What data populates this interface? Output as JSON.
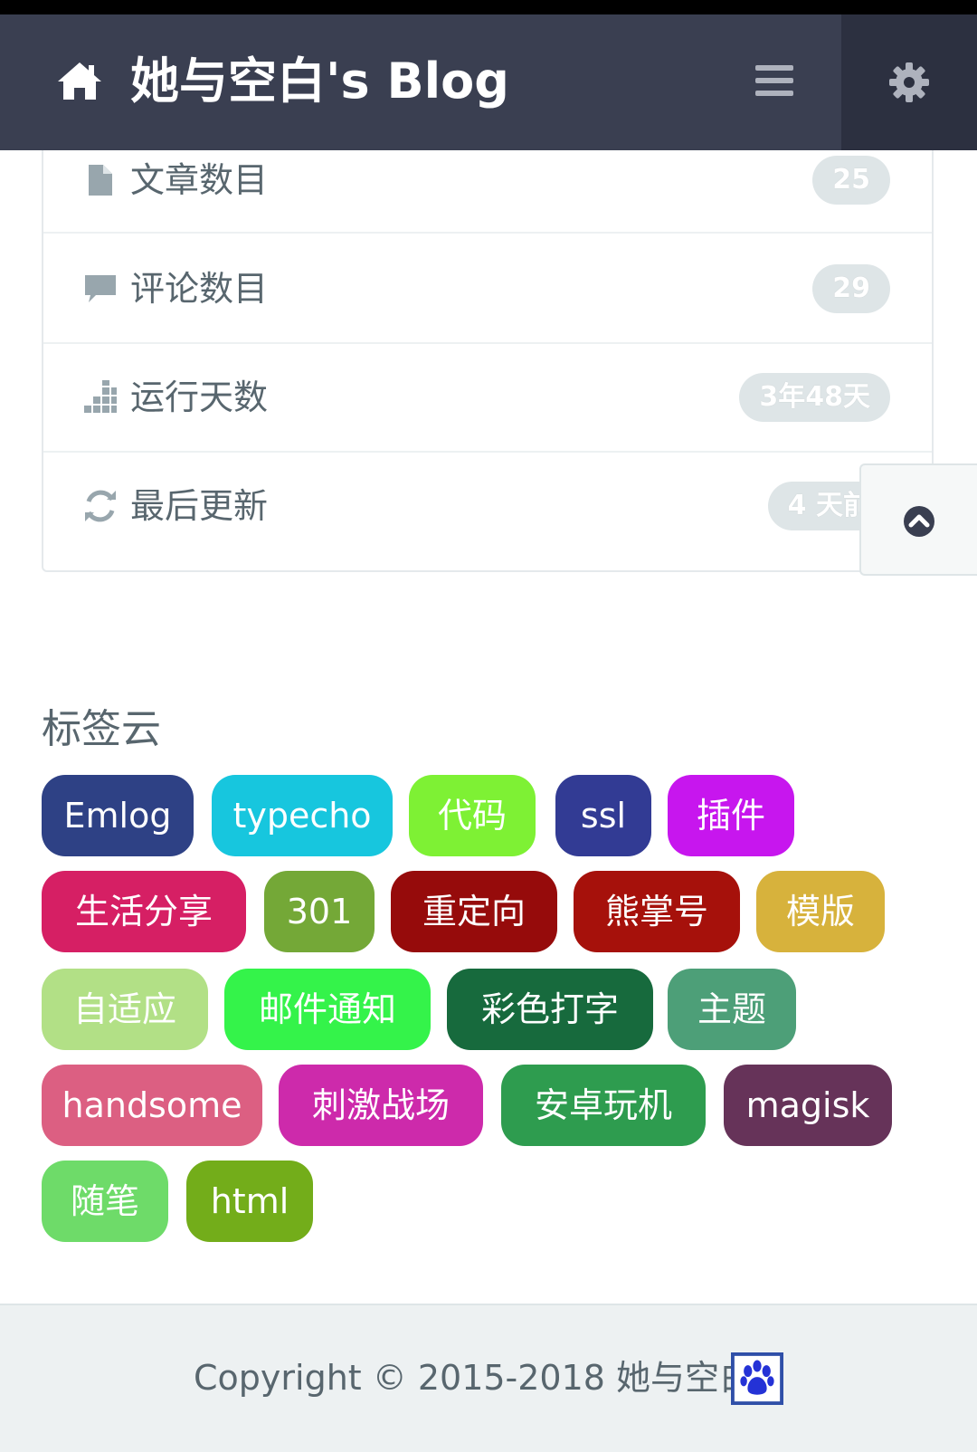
{
  "header": {
    "brand": "她与空白's Blog",
    "home_icon": "home-icon",
    "menu_icon": "menu-icon",
    "settings_icon": "gear-icon"
  },
  "stats": {
    "items": [
      {
        "icon": "file-icon",
        "label": "文章数目",
        "badge": "25"
      },
      {
        "icon": "comment-icon",
        "label": "评论数目",
        "badge": "29"
      },
      {
        "icon": "bar-chart-icon",
        "label": "运行天数",
        "badge": "3年48天"
      },
      {
        "icon": "refresh-icon",
        "label": "最后更新",
        "badge": "4 天前"
      }
    ]
  },
  "back_to_top_icon": "chevron-up-circle-icon",
  "tagcloud": {
    "title": "标签云",
    "tags": [
      {
        "label": "Emlog",
        "color": "#2e4185"
      },
      {
        "label": "typecho",
        "color": "#17c6de"
      },
      {
        "label": "代码",
        "color": "#7ef134"
      },
      {
        "label": "ssl",
        "color": "#323b94"
      },
      {
        "label": "插件",
        "color": "#c716ee"
      },
      {
        "label": "生活分享",
        "color": "#d61f64"
      },
      {
        "label": "301",
        "color": "#74a837"
      },
      {
        "label": "重定向",
        "color": "#960b0b"
      },
      {
        "label": "熊掌号",
        "color": "#a6110b"
      },
      {
        "label": "模版",
        "color": "#d7b23c"
      },
      {
        "label": "自适应",
        "color": "#b2e086"
      },
      {
        "label": "邮件通知",
        "color": "#34f34a"
      },
      {
        "label": "彩色打字",
        "color": "#176a3d"
      },
      {
        "label": "主题",
        "color": "#4d9f78"
      },
      {
        "label": "handsome",
        "color": "#dc5f82"
      },
      {
        "label": "刺激战场",
        "color": "#cd2aab"
      },
      {
        "label": "安卓玩机",
        "color": "#2e9c4f"
      },
      {
        "label": "magisk",
        "color": "#663359"
      },
      {
        "label": "随笔",
        "color": "#6edb69"
      },
      {
        "label": "html",
        "color": "#73ad1a"
      }
    ]
  },
  "footer": {
    "copyright": "Copyright © 2015-2018  她与空白",
    "logo_icon": "paw-icon"
  }
}
